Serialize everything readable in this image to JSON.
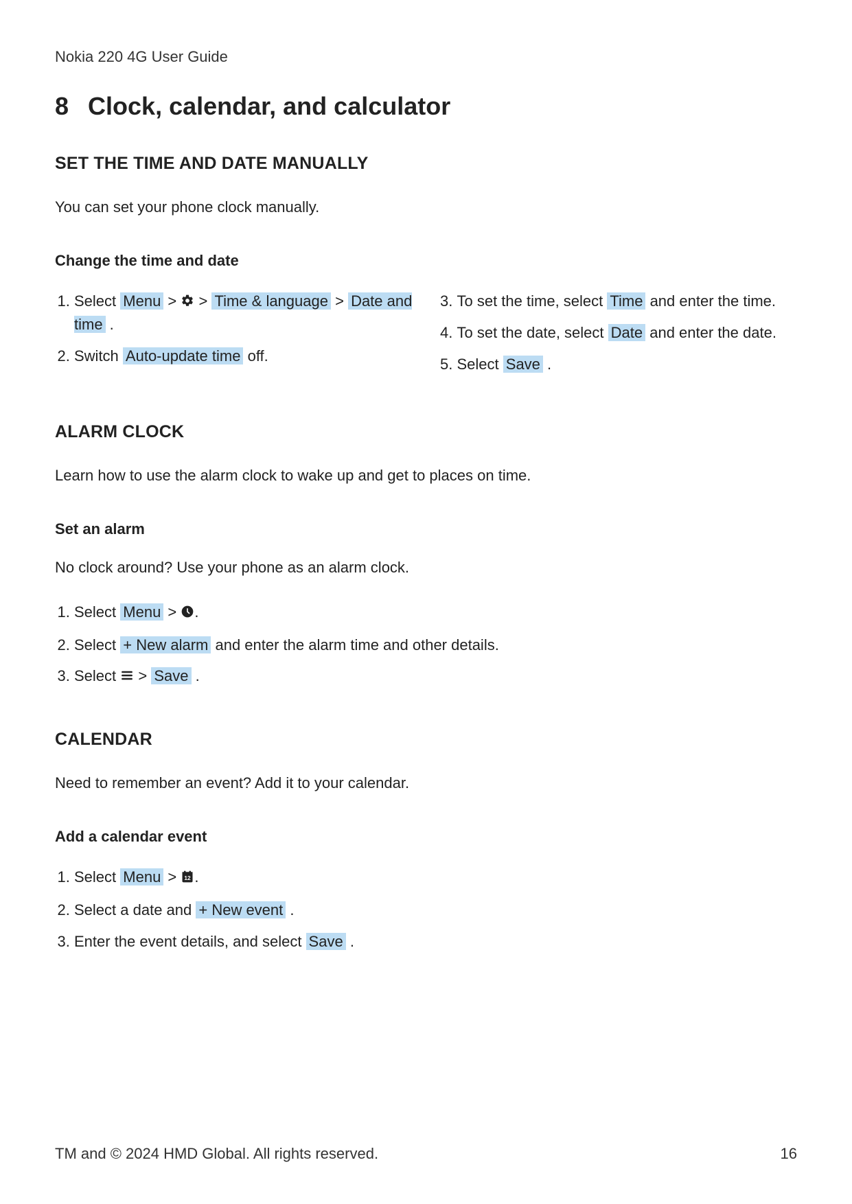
{
  "runningHead": "Nokia 220 4G User Guide",
  "chapter": {
    "num": "8",
    "title": "Clock, calendar, and calculator"
  },
  "timeDate": {
    "heading": "SET THE TIME AND DATE MANUALLY",
    "intro": "You can set your phone clock manually.",
    "sub": "Change the time and date",
    "s1a": "Select ",
    "s1menu": "Menu",
    "s1b": " > ",
    "s1c": " > ",
    "s1tl": "Time & language",
    "s1d": " > ",
    "s1dt": "Date and time",
    "s1e": " .",
    "s2a": "Switch ",
    "s2au": "Auto-update time",
    "s2b": " off.",
    "s3a": "To set the time, select ",
    "s3time": "Time",
    "s3b": " and enter the time.",
    "s4a": "To set the date, select ",
    "s4date": "Date",
    "s4b": " and enter the date.",
    "s5a": "Select ",
    "s5save": "Save",
    "s5b": " ."
  },
  "alarm": {
    "heading": "ALARM CLOCK",
    "intro": "Learn how to use the alarm clock to wake up and get to places on time.",
    "sub": "Set an alarm",
    "intro2": "No clock around? Use your phone as an alarm clock.",
    "s1a": "Select ",
    "s1menu": "Menu",
    "s1b": " > ",
    "s1c": ".",
    "s2a": "Select ",
    "s2new": "+ New alarm",
    "s2b": " and enter the alarm time and other details.",
    "s3a": "Select ",
    "s3b": " > ",
    "s3save": "Save",
    "s3c": " ."
  },
  "calendar": {
    "heading": "CALENDAR",
    "intro": "Need to remember an event? Add it to your calendar.",
    "sub": "Add a calendar event",
    "s1a": "Select ",
    "s1menu": "Menu",
    "s1b": " > ",
    "s1c": ".",
    "s2a": "Select a date and ",
    "s2new": "+ New event",
    "s2b": " .",
    "s3a": "Enter the event details, and select ",
    "s3save": "Save",
    "s3b": " ."
  },
  "footer": {
    "copyright": "TM and © 2024 HMD Global. All rights reserved.",
    "pageNum": "16"
  }
}
